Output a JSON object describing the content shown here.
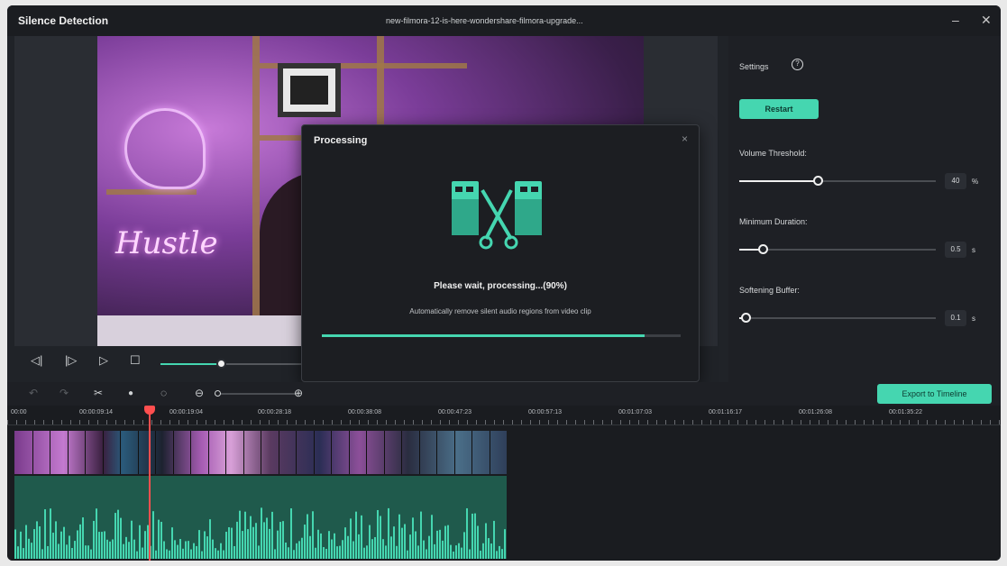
{
  "window": {
    "title": "Silence Detection",
    "file_name": "new-filmora-12-is-here-wondershare-filmora-upgrade...",
    "minimize_glyph": "–",
    "close_glyph": "✕"
  },
  "preview": {
    "controls": {
      "prev_frame_glyph": "◁|",
      "next_frame_glyph": "|▷",
      "play_glyph": "▷",
      "stop_glyph": "☐"
    },
    "progress_fraction": 0.42
  },
  "settings": {
    "title": "Settings",
    "help_glyph": "?",
    "restart_label": "Restart",
    "volume_threshold": {
      "label": "Volume Threshold:",
      "value": "40",
      "unit": "%",
      "fraction": 0.4
    },
    "minimum_duration": {
      "label": "Minimum Duration:",
      "value": "0.5",
      "unit": "s",
      "fraction": 0.12
    },
    "softening_buffer": {
      "label": "Softening Buffer:",
      "value": "0.1",
      "unit": "s",
      "fraction": 0.03
    }
  },
  "dialog": {
    "title": "Processing",
    "close_glyph": "×",
    "message": "Please wait, processing...(90%)",
    "sub_message": "Automatically remove silent audio regions from video clip",
    "progress_fraction": 0.9
  },
  "timeline": {
    "toolbar": {
      "undo_glyph": "↶",
      "redo_glyph": "↷",
      "cut_glyph": "✂",
      "eye_glyph": "●",
      "hide_glyph": "◌",
      "zoom_out_glyph": "⊖",
      "zoom_in_glyph": "⊕",
      "export_label": "Export to Timeline"
    },
    "ruler_labels": [
      "00:00",
      "00:00:09:14",
      "00:00:19:04",
      "00:00:28:18",
      "00:00:38:08",
      "00:00:47:23",
      "00:00:57:13",
      "00:01:07:03",
      "00:01:16:17",
      "00:01:26:08",
      "00:01:35:22"
    ]
  },
  "colors": {
    "accent": "#45d6b0",
    "playhead": "#ff4f4f",
    "background": "#202328"
  }
}
